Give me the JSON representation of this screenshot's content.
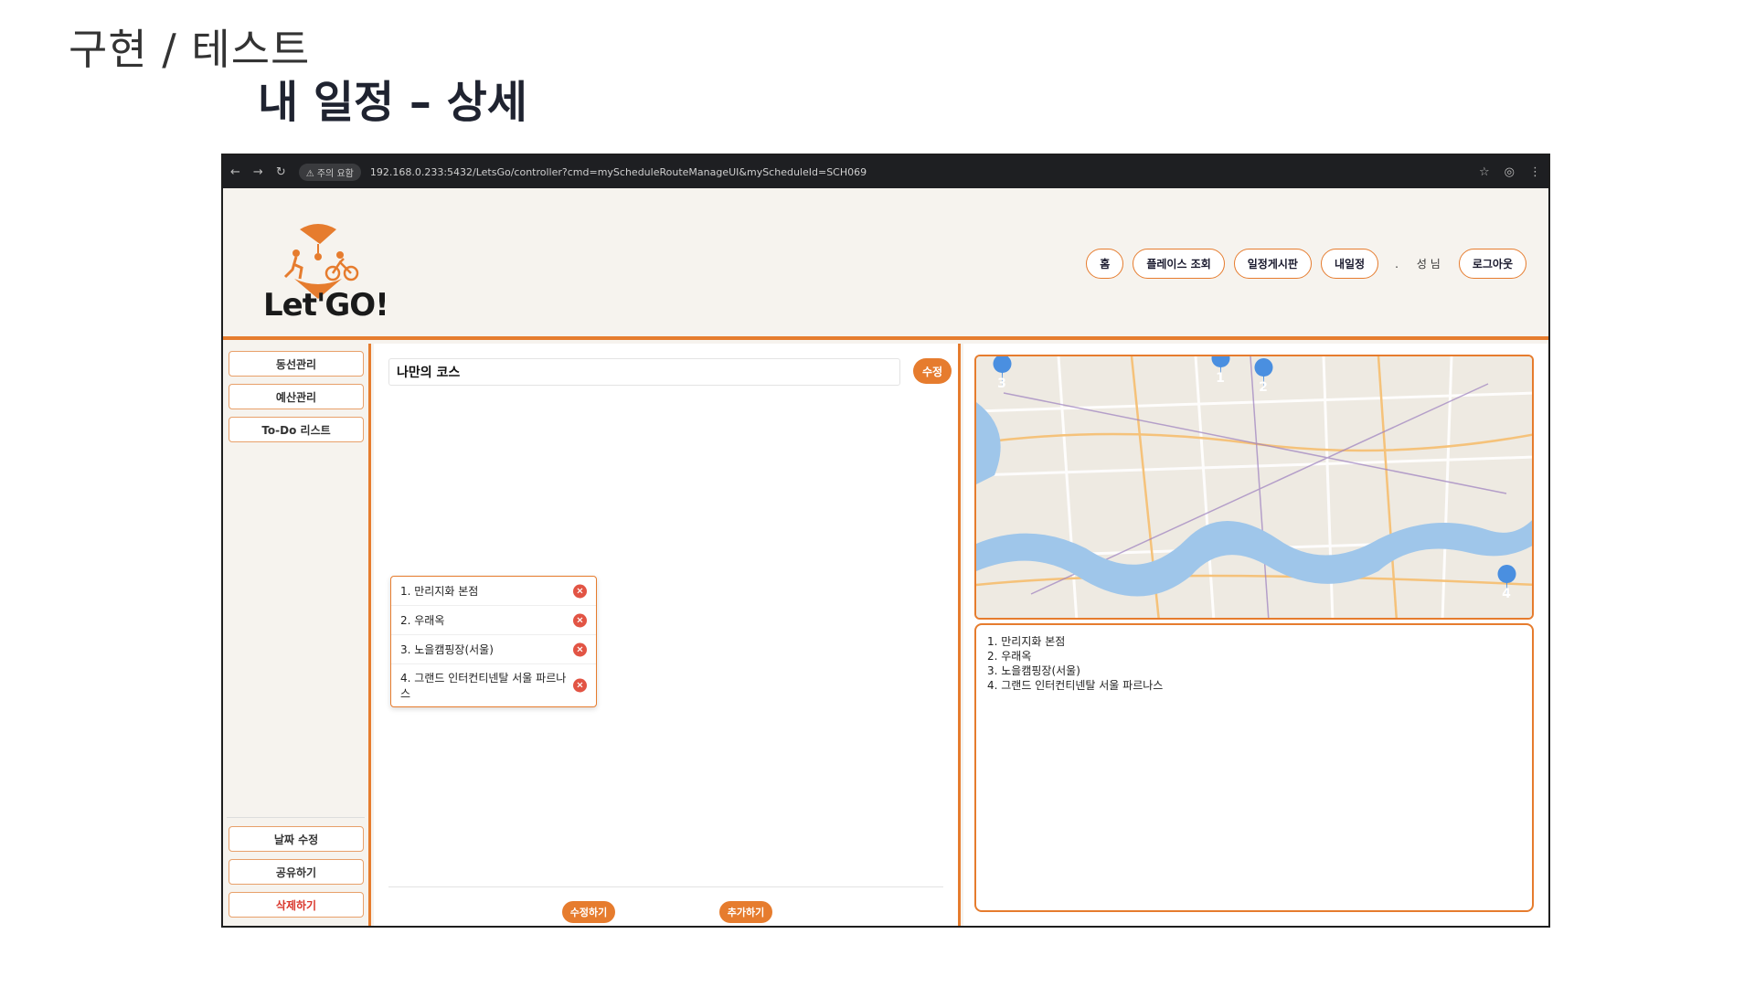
{
  "slide": {
    "title": "구현 / 테스트",
    "subtitle": "내 일정 – 상세"
  },
  "browser": {
    "warning_chip": "⚠ 주의 요함",
    "url": "192.168.0.233:5432/LetsGo/controller?cmd=myScheduleRouteManageUI&myScheduleId=SCH069"
  },
  "header": {
    "logo_text": "Let'GO!",
    "nav": {
      "home": "홈",
      "place_search": "플레이스 조회",
      "schedule_board": "일정게시판",
      "my_schedule": "내일정",
      "dot": ".",
      "user_greeting": "성 님",
      "logout": "로그아웃"
    }
  },
  "sidebar": {
    "items": [
      {
        "label": "동선관리"
      },
      {
        "label": "예산관리"
      },
      {
        "label": "To-Do 리스트"
      }
    ],
    "bottom_items": [
      {
        "label": "날짜 수정"
      },
      {
        "label": "공유하기"
      },
      {
        "label": "삭제하기"
      }
    ]
  },
  "main": {
    "course_title": "나만의 코스",
    "edit_title_button": "수정",
    "route": [
      {
        "label": "1. 만리지화 본점"
      },
      {
        "label": "2. 우래옥"
      },
      {
        "label": "3. 노을캠핑장(서울)"
      },
      {
        "label": "4. 그랜드 인터컨티넨탈 서울 파르나스"
      }
    ],
    "delete_icon": "×",
    "save_button": "수정하기",
    "add_button": "추가하기"
  },
  "map": {
    "markers": [
      "1",
      "2",
      "3",
      "4"
    ]
  },
  "summary": {
    "lines": [
      "1. 만리지화 본점",
      "2. 우래옥",
      "3. 노을캠핑장(서울)",
      "4. 그랜드 인터컨티넨탈 서울 파르나스"
    ]
  },
  "colors": {
    "accent": "#e67c2e",
    "delete": "#e25444",
    "marker": "#4a8fe0",
    "river": "#9fc6ea"
  }
}
